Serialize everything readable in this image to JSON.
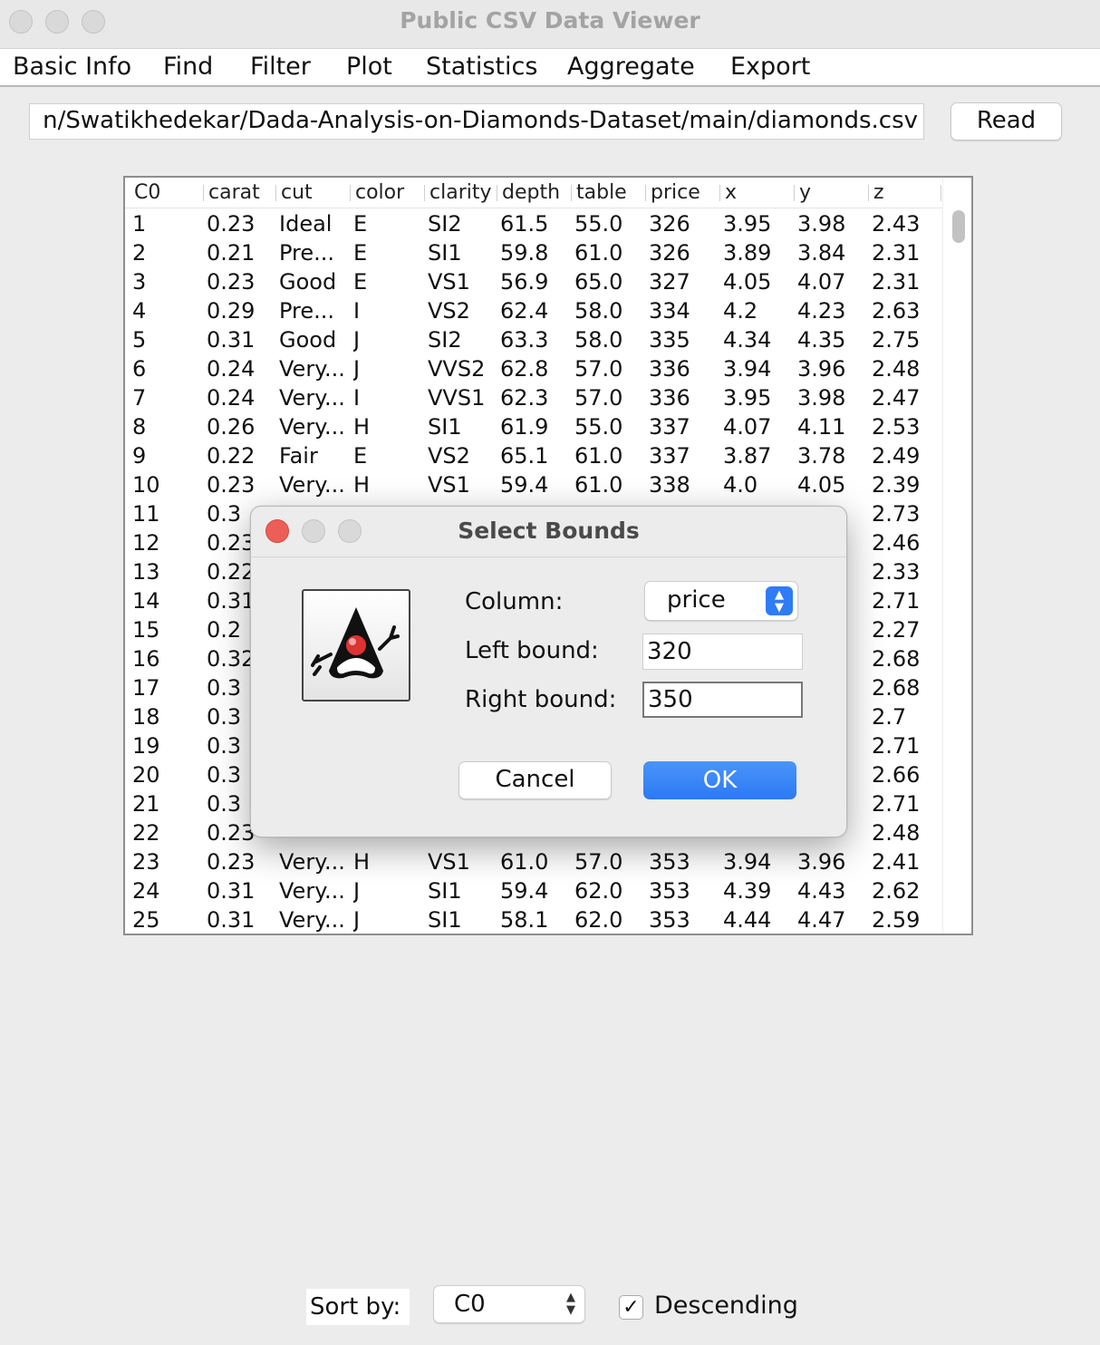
{
  "window": {
    "title": "Public CSV Data Viewer"
  },
  "menu": {
    "items": [
      "Basic Info",
      "Find",
      "Filter",
      "Plot",
      "Statistics",
      "Aggregate",
      "Export"
    ]
  },
  "source": {
    "url_visible": "n/Swatikhedekar/Dada-Analysis-on-Diamonds-Dataset/main/diamonds.csv",
    "read_label": "Read"
  },
  "table": {
    "columns": [
      "C0",
      "carat",
      "cut",
      "color",
      "clarity",
      "depth",
      "table",
      "price",
      "x",
      "y",
      "z"
    ],
    "rows": [
      [
        "1",
        "0.23",
        "Ideal",
        "E",
        "SI2",
        "61.5",
        "55.0",
        "326",
        "3.95",
        "3.98",
        "2.43"
      ],
      [
        "2",
        "0.21",
        "Pre...",
        "E",
        "SI1",
        "59.8",
        "61.0",
        "326",
        "3.89",
        "3.84",
        "2.31"
      ],
      [
        "3",
        "0.23",
        "Good",
        "E",
        "VS1",
        "56.9",
        "65.0",
        "327",
        "4.05",
        "4.07",
        "2.31"
      ],
      [
        "4",
        "0.29",
        "Pre...",
        "I",
        "VS2",
        "62.4",
        "58.0",
        "334",
        "4.2",
        "4.23",
        "2.63"
      ],
      [
        "5",
        "0.31",
        "Good",
        "J",
        "SI2",
        "63.3",
        "58.0",
        "335",
        "4.34",
        "4.35",
        "2.75"
      ],
      [
        "6",
        "0.24",
        "Very...",
        "J",
        "VVS2",
        "62.8",
        "57.0",
        "336",
        "3.94",
        "3.96",
        "2.48"
      ],
      [
        "7",
        "0.24",
        "Very...",
        "I",
        "VVS1",
        "62.3",
        "57.0",
        "336",
        "3.95",
        "3.98",
        "2.47"
      ],
      [
        "8",
        "0.26",
        "Very...",
        "H",
        "SI1",
        "61.9",
        "55.0",
        "337",
        "4.07",
        "4.11",
        "2.53"
      ],
      [
        "9",
        "0.22",
        "Fair",
        "E",
        "VS2",
        "65.1",
        "61.0",
        "337",
        "3.87",
        "3.78",
        "2.49"
      ],
      [
        "10",
        "0.23",
        "Very...",
        "H",
        "VS1",
        "59.4",
        "61.0",
        "338",
        "4.0",
        "4.05",
        "2.39"
      ],
      [
        "11",
        "0.3",
        "",
        "",
        "",
        "",
        "",
        "",
        "",
        "",
        "2.73"
      ],
      [
        "12",
        "0.23",
        "",
        "",
        "",
        "",
        "",
        "",
        "",
        "",
        "2.46"
      ],
      [
        "13",
        "0.22",
        "",
        "",
        "",
        "",
        "",
        "",
        "",
        "",
        "2.33"
      ],
      [
        "14",
        "0.31",
        "",
        "",
        "",
        "",
        "",
        "",
        "",
        "",
        "2.71"
      ],
      [
        "15",
        "0.2",
        "",
        "",
        "",
        "",
        "",
        "",
        "",
        "",
        "2.27"
      ],
      [
        "16",
        "0.32",
        "",
        "",
        "",
        "",
        "",
        "",
        "",
        "",
        "2.68"
      ],
      [
        "17",
        "0.3",
        "",
        "",
        "",
        "",
        "",
        "",
        "",
        "",
        "2.68"
      ],
      [
        "18",
        "0.3",
        "",
        "",
        "",
        "",
        "",
        "",
        "",
        "",
        "2.7"
      ],
      [
        "19",
        "0.3",
        "",
        "",
        "",
        "",
        "",
        "",
        "",
        "",
        "2.71"
      ],
      [
        "20",
        "0.3",
        "",
        "",
        "",
        "",
        "",
        "",
        "",
        "",
        "2.66"
      ],
      [
        "21",
        "0.3",
        "",
        "",
        "",
        "",
        "",
        "",
        "",
        "",
        "2.71"
      ],
      [
        "22",
        "0.23",
        "",
        "",
        "",
        "",
        "",
        "",
        "",
        "",
        "2.48"
      ],
      [
        "23",
        "0.23",
        "Very...",
        "H",
        "VS1",
        "61.0",
        "57.0",
        "353",
        "3.94",
        "3.96",
        "2.41"
      ],
      [
        "24",
        "0.31",
        "Very...",
        "J",
        "SI1",
        "59.4",
        "62.0",
        "353",
        "4.39",
        "4.43",
        "2.62"
      ],
      [
        "25",
        "0.31",
        "Very...",
        "J",
        "SI1",
        "58.1",
        "62.0",
        "353",
        "4.44",
        "4.47",
        "2.59"
      ]
    ]
  },
  "dialog": {
    "title": "Select Bounds",
    "icon": "java-duke-icon",
    "column_label": "Column:",
    "column_value": "price",
    "left_label": "Left bound:",
    "left_value": "320",
    "right_label": "Right bound:",
    "right_value": "350",
    "cancel_label": "Cancel",
    "ok_label": "OK"
  },
  "bottom": {
    "sort_label": "Sort by:",
    "sort_value": "C0",
    "descending_label": "Descending",
    "descending_checked": true
  },
  "colors": {
    "accent": "#2f7cf6",
    "close_red": "#ec5f58"
  }
}
